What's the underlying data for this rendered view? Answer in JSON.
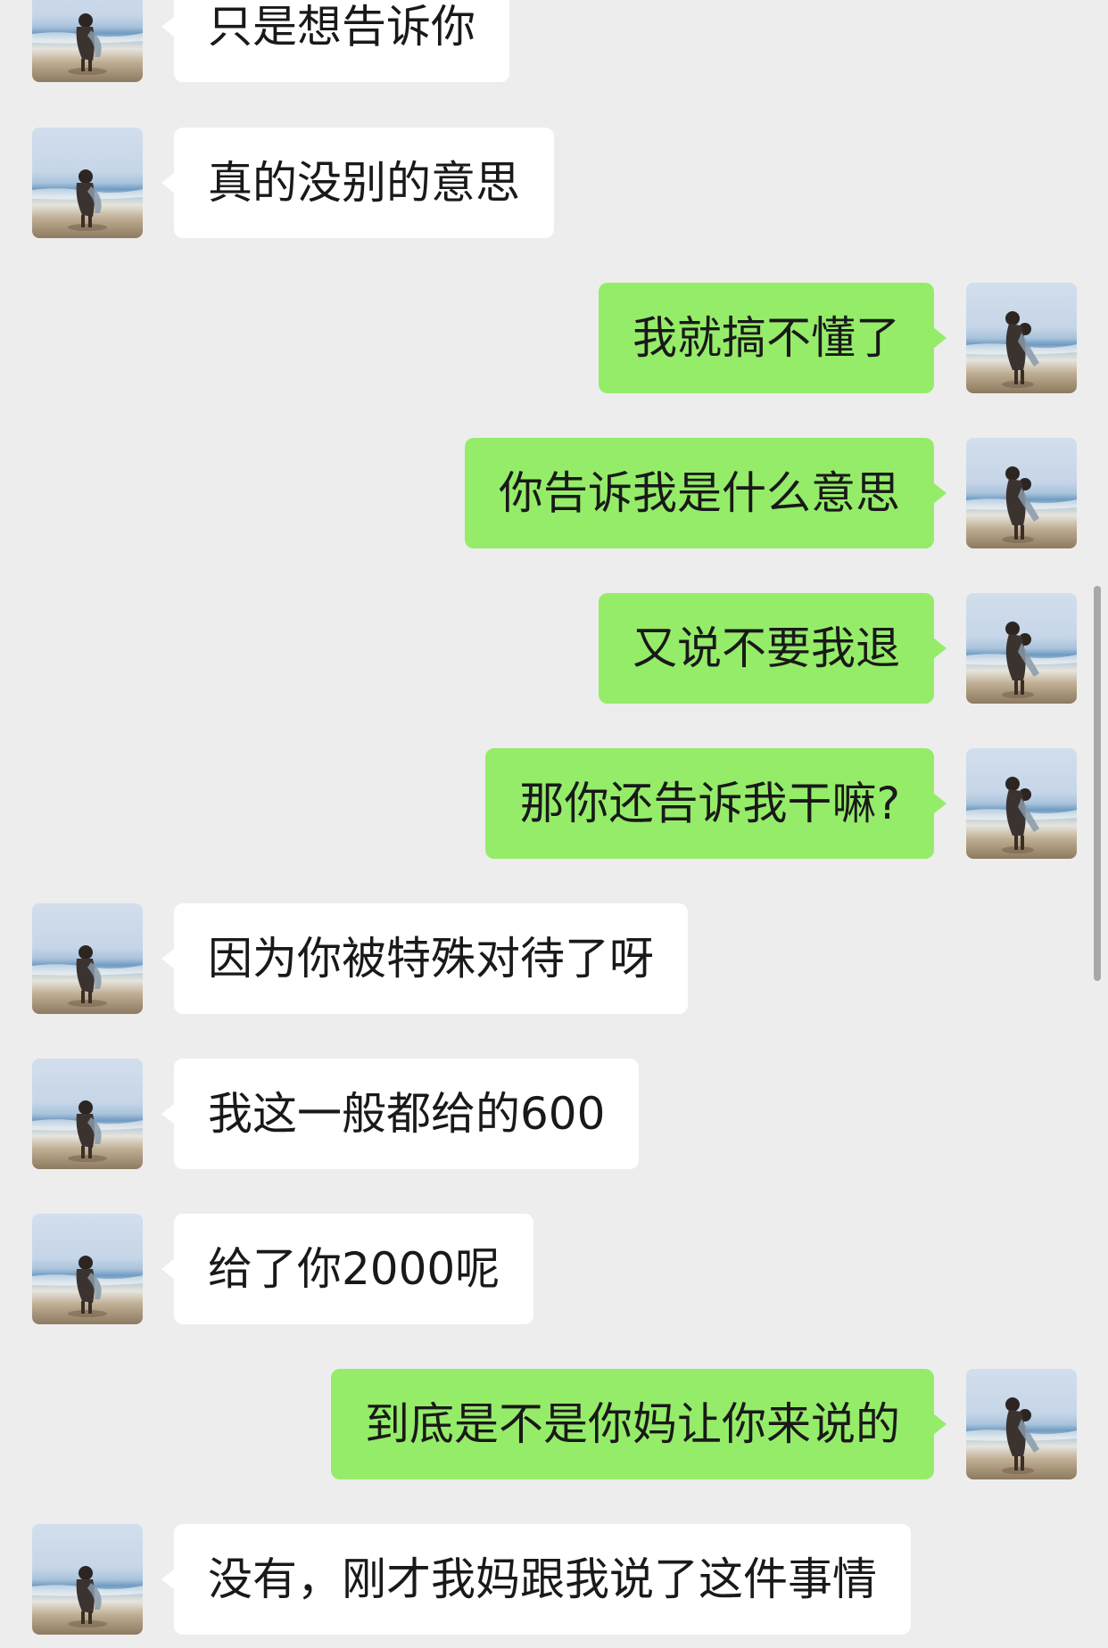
{
  "messages": [
    {
      "side": "left",
      "text": "只是想告诉你"
    },
    {
      "side": "left",
      "text": "真的没别的意思"
    },
    {
      "side": "right",
      "text": "我就搞不懂了"
    },
    {
      "side": "right",
      "text": "你告诉我是什么意思"
    },
    {
      "side": "right",
      "text": "又说不要我退"
    },
    {
      "side": "right",
      "text": "那你还告诉我干嘛?"
    },
    {
      "side": "left",
      "text": "因为你被特殊对待了呀"
    },
    {
      "side": "left",
      "text": "我这一般都给的600"
    },
    {
      "side": "left",
      "text": "给了你2000呢"
    },
    {
      "side": "right",
      "text": "到底是不是你妈让你来说的"
    },
    {
      "side": "left",
      "text": "没有，刚才我妈跟我说了这件事情"
    }
  ],
  "colors": {
    "background": "#ededed",
    "incoming_bubble": "#ffffff",
    "outgoing_bubble": "#95ec69",
    "text": "#191919"
  },
  "icons": {
    "incoming_avatar": "contact-avatar-beach-photo",
    "outgoing_avatar": "self-avatar-beach-photo"
  }
}
